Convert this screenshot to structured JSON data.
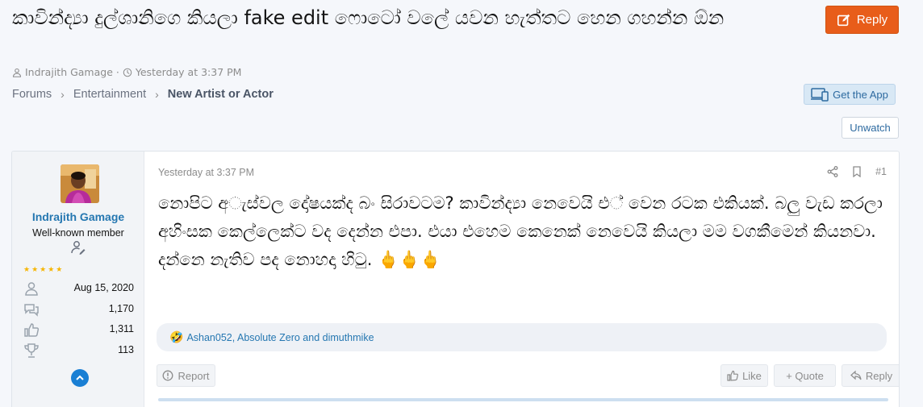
{
  "thread": {
    "title": "කාවින්ද්‍යා දුල්ශානිගෙ කියලා fake edit ෆොටෝ වලේ යවන හැත්තට හෙන ගහන්න ඕන",
    "author": "Indrajith Gamage",
    "meta_sep": "·",
    "date": "Yesterday at 3:37 PM"
  },
  "header": {
    "reply_label": "Reply",
    "get_app_label": "Get the App",
    "unwatch_label": "Unwatch"
  },
  "breadcrumb": [
    "Forums",
    "Entertainment",
    "New Artist or Actor"
  ],
  "breadcrumb_sep": "›",
  "post": {
    "user": {
      "name": "Indrajith Gamage",
      "title": "Well-known member",
      "stars": "★★★★★",
      "joined": "Aug 15, 2020",
      "messages": "1,170",
      "reactions": "1,311",
      "points": "113"
    },
    "date": "Yesterday at 3:37 PM",
    "number": "#1",
    "body": "නොපිට අ◌ැස්වල දෝෂයක්ද බං සිරාවටම? කාවින්ද්‍යා නෙවෙයි එ◌් වෙන රටක එකියක්. බලු වැඩ කරලා අහිංසක කෙල්ලෙක්ට වද දෙන්න එපා. එයා එහෙම කෙනෙක් නෙවෙයි කියලා මම වගකීමෙන් කියනවා. දන්නෙ නැතිව පද නොහදා හිටු. 🖕🖕🖕",
    "reactions_emoji": "🤣",
    "reactions_text": "Ashan052, Absolute Zero and dimuthmike",
    "actions": {
      "report": "Report",
      "like": "Like",
      "quote": "+ Quote",
      "reply": "Reply"
    }
  },
  "colors": {
    "accent": "#e85d1a",
    "link": "#2577b1",
    "muted": "#8c8c8c"
  }
}
